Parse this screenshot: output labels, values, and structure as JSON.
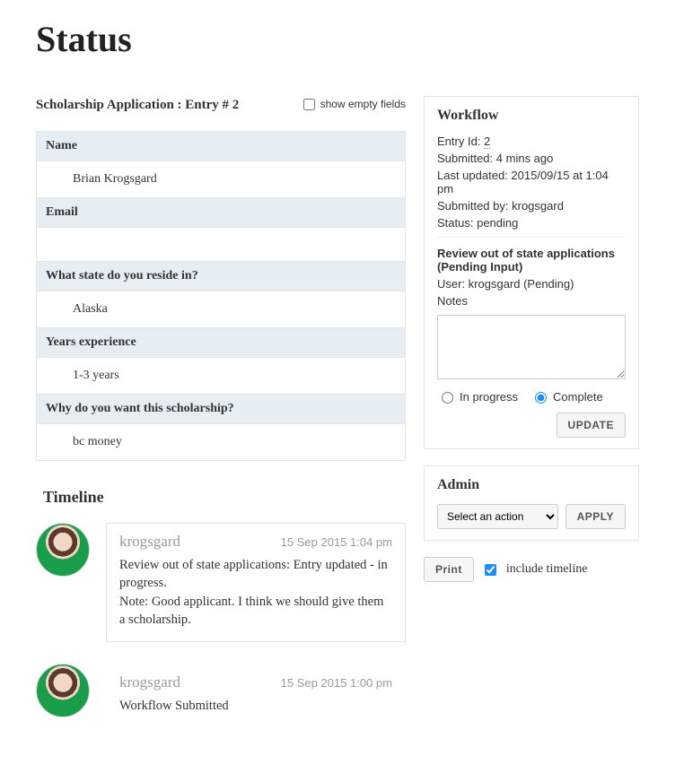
{
  "page": {
    "title": "Status"
  },
  "entry": {
    "title": "Scholarship Application : Entry # 2",
    "show_empty_label": "show empty fields",
    "fields": [
      {
        "label": "Name",
        "value": "Brian Krogsgard"
      },
      {
        "label": "Email",
        "value": ""
      },
      {
        "label": "What state do you reside in?",
        "value": "Alaska"
      },
      {
        "label": "Years experience",
        "value": "1-3 years"
      },
      {
        "label": "Why do you want this scholarship?",
        "value": "bc money"
      }
    ]
  },
  "timeline": {
    "heading": "Timeline",
    "items": [
      {
        "user": "krogsgard",
        "date": "15 Sep 2015 1:04 pm",
        "body": "Review out of state applications: Entry updated - in progress.\nNote: Good applicant. I think we should give them a scholarship."
      },
      {
        "user": "krogsgard",
        "date": "15 Sep 2015 1:00 pm",
        "body": "Workflow Submitted"
      }
    ]
  },
  "workflow": {
    "heading": "Workflow",
    "entry_id_label": "Entry Id:",
    "entry_id": "2",
    "submitted_label": "Submitted:",
    "submitted": "4 mins ago",
    "last_updated_label": "Last updated:",
    "last_updated": "2015/09/15 at 1:04 pm",
    "submitted_by_label": "Submitted by:",
    "submitted_by": "krogsgard",
    "status_label": "Status:",
    "status": "pending",
    "step_title": "Review out of state applications (Pending Input)",
    "user_line": "User: krogsgard (Pending)",
    "notes_label": "Notes",
    "radio_in_progress": "In progress",
    "radio_complete": "Complete",
    "update_btn": "UPDATE"
  },
  "admin": {
    "heading": "Admin",
    "select_placeholder": "Select an action",
    "apply_btn": "APPLY"
  },
  "print": {
    "button": "Print",
    "include_label": "include timeline"
  }
}
